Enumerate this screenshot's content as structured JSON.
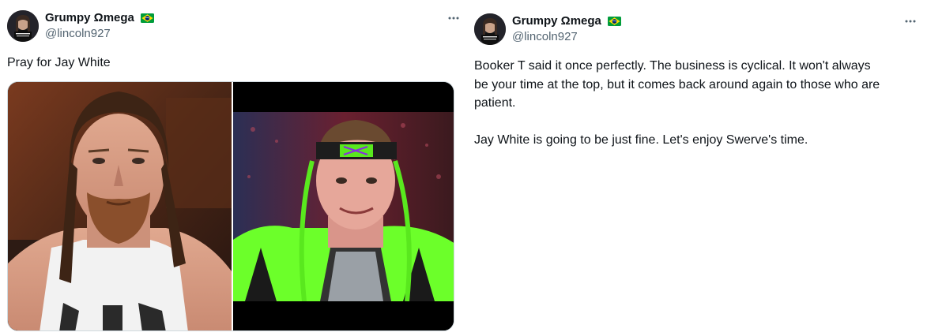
{
  "tweets": [
    {
      "author": {
        "display_name": "Grumpy Ωmega",
        "flag_icon": "brazil-flag-icon",
        "handle": "@lincoln927",
        "avatar_icon": "avatar-image"
      },
      "text": "Pray for Jay White",
      "more_icon": "more-options-icon",
      "media": {
        "images": [
          "wrestler-photo-left",
          "wrestler-photo-right"
        ]
      }
    },
    {
      "author": {
        "display_name": "Grumpy Ωmega",
        "flag_icon": "brazil-flag-icon",
        "handle": "@lincoln927",
        "avatar_icon": "avatar-image"
      },
      "text": "Booker T said it once perfectly. The business is cyclical. It won't always\nbe your time at the top, but it comes back around again to those who are\npatient.\n\nJay White is going to be just fine. Let's enjoy Swerve's time.",
      "more_icon": "more-options-icon"
    }
  ],
  "colors": {
    "text_primary": "#0f1419",
    "text_secondary": "#536471",
    "border": "#cfd9de",
    "flag_green": "#009c3b",
    "flag_yellow": "#ffdf00",
    "flag_blue": "#002776"
  }
}
